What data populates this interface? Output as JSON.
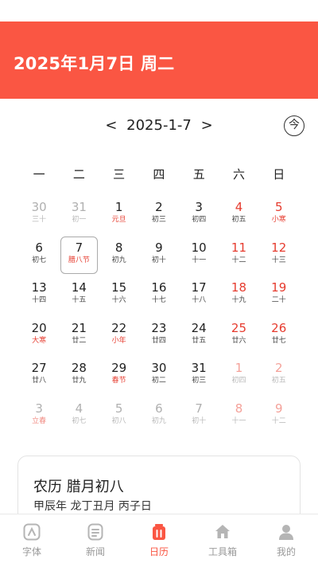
{
  "header": {
    "title": "2025年1月7日  周二"
  },
  "nav": {
    "prev": "<",
    "current": "2025-1-7",
    "next": ">",
    "today_label": "今"
  },
  "weekdays": [
    "一",
    "二",
    "三",
    "四",
    "五",
    "六",
    "日"
  ],
  "calendar": {
    "rows": [
      [
        {
          "d": "30",
          "l": "三十",
          "c": "gray"
        },
        {
          "d": "31",
          "l": "初一",
          "c": "gray"
        },
        {
          "d": "1",
          "l": "元旦",
          "c": "black",
          "lc": "red"
        },
        {
          "d": "2",
          "l": "初三",
          "c": "black"
        },
        {
          "d": "3",
          "l": "初四",
          "c": "black"
        },
        {
          "d": "4",
          "l": "初五",
          "c": "red"
        },
        {
          "d": "5",
          "l": "小寒",
          "c": "red",
          "lc": "red"
        }
      ],
      [
        {
          "d": "6",
          "l": "初七",
          "c": "black"
        },
        {
          "d": "7",
          "l": "腊八节",
          "c": "black",
          "lc": "red",
          "sel": true
        },
        {
          "d": "8",
          "l": "初九",
          "c": "black"
        },
        {
          "d": "9",
          "l": "初十",
          "c": "black"
        },
        {
          "d": "10",
          "l": "十一",
          "c": "black"
        },
        {
          "d": "11",
          "l": "十二",
          "c": "red"
        },
        {
          "d": "12",
          "l": "十三",
          "c": "red"
        }
      ],
      [
        {
          "d": "13",
          "l": "十四",
          "c": "black"
        },
        {
          "d": "14",
          "l": "十五",
          "c": "black"
        },
        {
          "d": "15",
          "l": "十六",
          "c": "black"
        },
        {
          "d": "16",
          "l": "十七",
          "c": "black"
        },
        {
          "d": "17",
          "l": "十八",
          "c": "black"
        },
        {
          "d": "18",
          "l": "十九",
          "c": "red"
        },
        {
          "d": "19",
          "l": "二十",
          "c": "red"
        }
      ],
      [
        {
          "d": "20",
          "l": "大寒",
          "c": "black",
          "lc": "red"
        },
        {
          "d": "21",
          "l": "廿二",
          "c": "black"
        },
        {
          "d": "22",
          "l": "小年",
          "c": "black",
          "lc": "red"
        },
        {
          "d": "23",
          "l": "廿四",
          "c": "black"
        },
        {
          "d": "24",
          "l": "廿五",
          "c": "black"
        },
        {
          "d": "25",
          "l": "廿六",
          "c": "red"
        },
        {
          "d": "26",
          "l": "廿七",
          "c": "red"
        }
      ],
      [
        {
          "d": "27",
          "l": "廿八",
          "c": "black"
        },
        {
          "d": "28",
          "l": "廿九",
          "c": "black"
        },
        {
          "d": "29",
          "l": "春节",
          "c": "black",
          "lc": "red"
        },
        {
          "d": "30",
          "l": "初二",
          "c": "black"
        },
        {
          "d": "31",
          "l": "初三",
          "c": "black"
        },
        {
          "d": "1",
          "l": "初四",
          "c": "pink"
        },
        {
          "d": "2",
          "l": "初五",
          "c": "pink"
        }
      ],
      [
        {
          "d": "3",
          "l": "立春",
          "c": "gray",
          "lc": "pinkred"
        },
        {
          "d": "4",
          "l": "初七",
          "c": "gray"
        },
        {
          "d": "5",
          "l": "初八",
          "c": "gray"
        },
        {
          "d": "6",
          "l": "初九",
          "c": "gray"
        },
        {
          "d": "7",
          "l": "初十",
          "c": "gray"
        },
        {
          "d": "8",
          "l": "十一",
          "c": "pink"
        },
        {
          "d": "9",
          "l": "十二",
          "c": "pink"
        }
      ]
    ]
  },
  "info": {
    "lunar_date": "农历 腊月初八",
    "ganzhi": "甲辰年 龙丁丑月 丙子日"
  },
  "tabs": [
    {
      "label": "字体",
      "icon": "font-icon",
      "active": false
    },
    {
      "label": "新闻",
      "icon": "news-icon",
      "active": false
    },
    {
      "label": "日历",
      "icon": "calendar-icon",
      "active": true
    },
    {
      "label": "工具箱",
      "icon": "toolbox-icon",
      "active": false
    },
    {
      "label": "我的",
      "icon": "profile-icon",
      "active": false
    }
  ],
  "colors": {
    "accent": "#fa5643",
    "holiday_red": "#e63b2e",
    "inactive": "#9a9a9a"
  }
}
